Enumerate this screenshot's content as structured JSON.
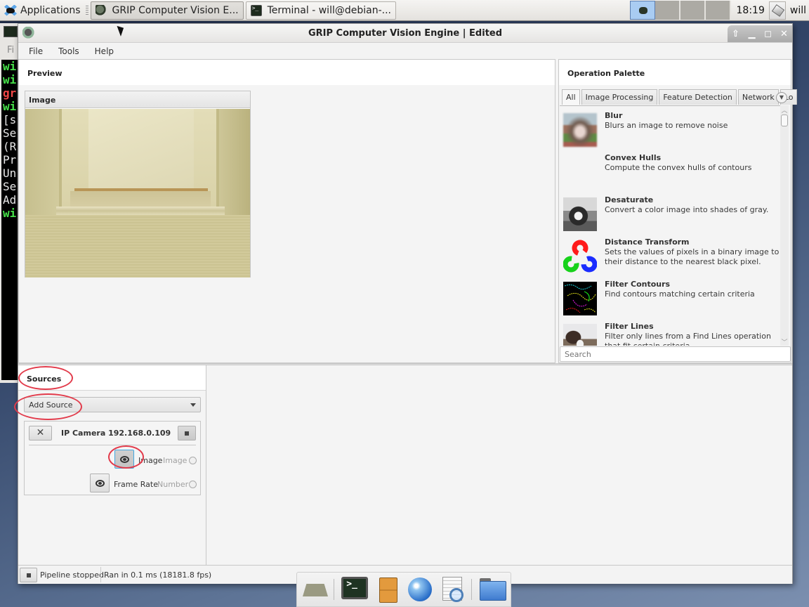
{
  "taskbar": {
    "applications_label": "Applications",
    "tasks": [
      {
        "label": "GRIP Computer Vision E...",
        "icon": "grip-icon",
        "active": true
      },
      {
        "label": "Terminal - will@debian-...",
        "icon": "terminal-icon",
        "active": false
      }
    ],
    "workspaces": 4,
    "current_workspace": 1,
    "clock": "18:19",
    "user": "will"
  },
  "terminal_background": {
    "menu_fragment": "Fi",
    "lines": [
      {
        "text": "wi",
        "color": "green"
      },
      {
        "text": "wi",
        "color": "green"
      },
      {
        "text": "gr",
        "color": "red"
      },
      {
        "text": "wi",
        "color": "green"
      },
      {
        "text": "[s",
        "color": "white"
      },
      {
        "text": "Se",
        "color": "white"
      },
      {
        "text": "(R",
        "color": "white"
      },
      {
        "text": "Pr",
        "color": "white"
      },
      {
        "text": "Un",
        "color": "white"
      },
      {
        "text": "Se",
        "color": "white"
      },
      {
        "text": "Ad",
        "color": "white"
      },
      {
        "text": "wi",
        "color": "green"
      }
    ]
  },
  "window": {
    "title": "GRIP Computer Vision Engine | Edited",
    "controls": {
      "shade": "⇧",
      "minimize": "▁",
      "maximize": "◻",
      "close": "✕"
    },
    "menu": [
      "File",
      "Tools",
      "Help"
    ]
  },
  "preview": {
    "heading": "Preview",
    "card_title": "Image"
  },
  "palette": {
    "heading": "Operation Palette",
    "tabs": [
      "All",
      "Image Processing",
      "Feature Detection",
      "Network",
      "Lo"
    ],
    "selected_tab": "All",
    "operations": [
      {
        "name": "Blur",
        "description": "Blurs an image to remove noise",
        "thumb": "blur"
      },
      {
        "name": "Convex Hulls",
        "description": "Compute the convex hulls of contours",
        "thumb": "none"
      },
      {
        "name": "Desaturate",
        "description": "Convert a color image into shades of gray.",
        "thumb": "desaturate"
      },
      {
        "name": "Distance Transform",
        "description": "Sets the values of pixels in a binary image to their distance to the nearest black pixel.",
        "thumb": "opencv-logo"
      },
      {
        "name": "Filter Contours",
        "description": "Find contours matching certain criteria",
        "thumb": "contours"
      },
      {
        "name": "Filter Lines",
        "description": "Filter only lines from a Find Lines operation that fit certain criteria",
        "thumb": "lines"
      }
    ],
    "search_placeholder": "Search"
  },
  "sources": {
    "heading": "Sources",
    "add_source_label": "Add Source",
    "source": {
      "name": "IP Camera 192.168.0.109",
      "close_label": "✕",
      "sockets": [
        {
          "label": "Image",
          "type": "Image",
          "preview_on": true
        },
        {
          "label": "Frame Rate",
          "type": "Number",
          "preview_on": false
        }
      ]
    }
  },
  "statusbar": {
    "status": "Pipeline stopped",
    "timing": "Ran in 0.1 ms (18181.8 fps)"
  },
  "dock": [
    "show-desktop-icon",
    "terminal-icon",
    "file-cabinet-icon",
    "web-browser-icon",
    "search-icon",
    "folder-icon"
  ],
  "annotations": {
    "color": "#e23b4b",
    "highlighted": [
      "Sources",
      "Add Source",
      "Image preview toggle"
    ]
  }
}
